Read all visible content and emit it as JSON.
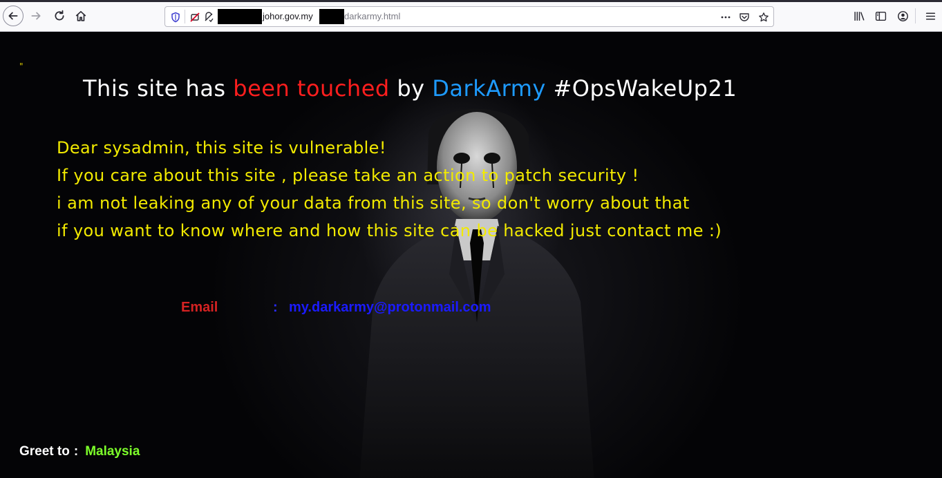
{
  "browser": {
    "url": {
      "host_fragment": "johor.gov.my",
      "path_fragment": "darkarmy.html"
    }
  },
  "page": {
    "quote_mark": "\"",
    "headline": {
      "part1": "This site has ",
      "part2": "been touched",
      "part3": " by ",
      "part4": "DarkArmy",
      "part5": " #OpsWakeUp21"
    },
    "message_lines": [
      "Dear sysadmin, this site is vulnerable!",
      "If you care about this site , please take an action to patch security !",
      "i am not leaking any of your data from this site, so don't worry about that",
      "if you want to know where and how this site can be hacked just contact me :)"
    ],
    "email": {
      "label": "Email",
      "colon": ":",
      "value": "my.darkarmy@protonmail.com"
    },
    "greet": {
      "label": "Greet to",
      "colon": ":",
      "value": "Malaysia"
    }
  },
  "colors": {
    "headline_red": "#ff1e1e",
    "headline_blue": "#1e9bff",
    "message_yellow": "#f2ea00",
    "email_label_red": "#d62222",
    "email_blue": "#1b1bff",
    "greet_green": "#7dff2a"
  },
  "icons": {
    "back": "arrow-left-icon",
    "forward": "arrow-right-icon",
    "reload": "reload-icon",
    "home": "home-icon",
    "shield": "shield-icon",
    "tracking": "tracking-blocked-icon",
    "permissions": "permissions-icon",
    "page_actions": "ellipsis-icon",
    "pocket": "pocket-icon",
    "bookmark": "star-icon",
    "library": "library-icon",
    "sidebar": "sidebar-icon",
    "account": "account-icon",
    "menu": "hamburger-menu-icon"
  }
}
